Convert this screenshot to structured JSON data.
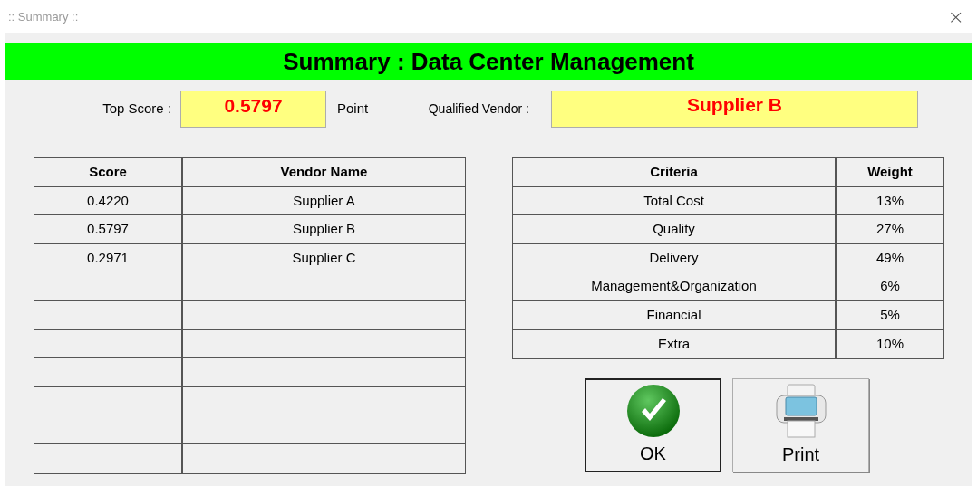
{
  "window": {
    "title": ":: Summary ::",
    "close": "×"
  },
  "header": "Summary : Data Center Management",
  "top_score": {
    "label": "Top Score :",
    "value": "0.5797",
    "unit": "Point"
  },
  "qualified_vendor": {
    "label": "Qualified Vendor :",
    "value": "Supplier B"
  },
  "scores": {
    "columns": [
      "Score",
      "Vendor Name"
    ],
    "rows": [
      [
        "0.4220",
        "Supplier A"
      ],
      [
        "0.5797",
        "Supplier B"
      ],
      [
        "0.2971",
        "Supplier C"
      ]
    ]
  },
  "criteria": {
    "columns": [
      "Criteria",
      "Weight"
    ],
    "rows": [
      [
        "Total Cost",
        "13%"
      ],
      [
        "Quality",
        "27%"
      ],
      [
        "Delivery",
        "49%"
      ],
      [
        "Management&Organization",
        "6%"
      ],
      [
        "Financial",
        "5%"
      ],
      [
        "Extra",
        "10%"
      ]
    ]
  },
  "buttons": [
    {
      "label": "OK",
      "kind": "ok",
      "default": true
    },
    {
      "label": "Print",
      "kind": "print",
      "default": false
    }
  ]
}
